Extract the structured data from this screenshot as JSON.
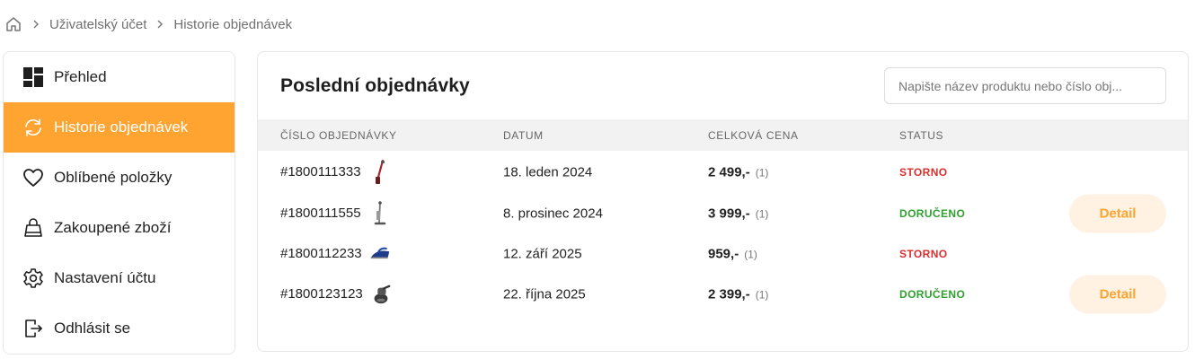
{
  "breadcrumb": {
    "home_icon": "home-icon",
    "items": [
      "Uživatelský účet",
      "Historie objednávek"
    ]
  },
  "sidebar": {
    "items": [
      {
        "label": "Přehled",
        "icon": "dashboard-icon",
        "active": false
      },
      {
        "label": "Historie objednávek",
        "icon": "refresh-icon",
        "active": true
      },
      {
        "label": "Oblíbené položky",
        "icon": "heart-icon",
        "active": false
      },
      {
        "label": "Zakoupené zboží",
        "icon": "shopping-bag-icon",
        "active": false
      },
      {
        "label": "Nastavení účtu",
        "icon": "gear-icon",
        "active": false
      },
      {
        "label": "Odhlásit se",
        "icon": "logout-icon",
        "active": false
      }
    ]
  },
  "main": {
    "title": "Poslední objednávky",
    "search_placeholder": "Napište název produktu nebo číslo obj...",
    "columns": [
      "ČÍSLO OBJEDNÁVKY",
      "DATUM",
      "CELKOVÁ CENA",
      "STATUS"
    ],
    "orders": [
      {
        "number": "#1800111333",
        "thumb": "stick-vacuum-red",
        "date": "18. leden 2024",
        "price": "2 499,-",
        "qty": "(1)",
        "status": "STORNO",
        "status_type": "storno",
        "detail": ""
      },
      {
        "number": "#1800111555",
        "thumb": "stick-vacuum-grey",
        "date": "8. prosinec 2024",
        "price": "3 999,-",
        "qty": "(1)",
        "status": "DORUČENO",
        "status_type": "delivered",
        "detail": "Detail"
      },
      {
        "number": "#1800112233",
        "thumb": "steam-iron",
        "date": "12. září 2025",
        "price": "959,-",
        "qty": "(1)",
        "status": "STORNO",
        "status_type": "storno",
        "detail": ""
      },
      {
        "number": "#1800123123",
        "thumb": "hand-vacuum",
        "date": "22. října 2025",
        "price": "2 399,-",
        "qty": "(1)",
        "status": "DORUČENO",
        "status_type": "delivered",
        "detail": "Detail"
      }
    ]
  },
  "colors": {
    "accent": "#ffa331",
    "accent_light": "#fff2e2",
    "storno": "#d9302f",
    "delivered": "#2fa12f"
  }
}
